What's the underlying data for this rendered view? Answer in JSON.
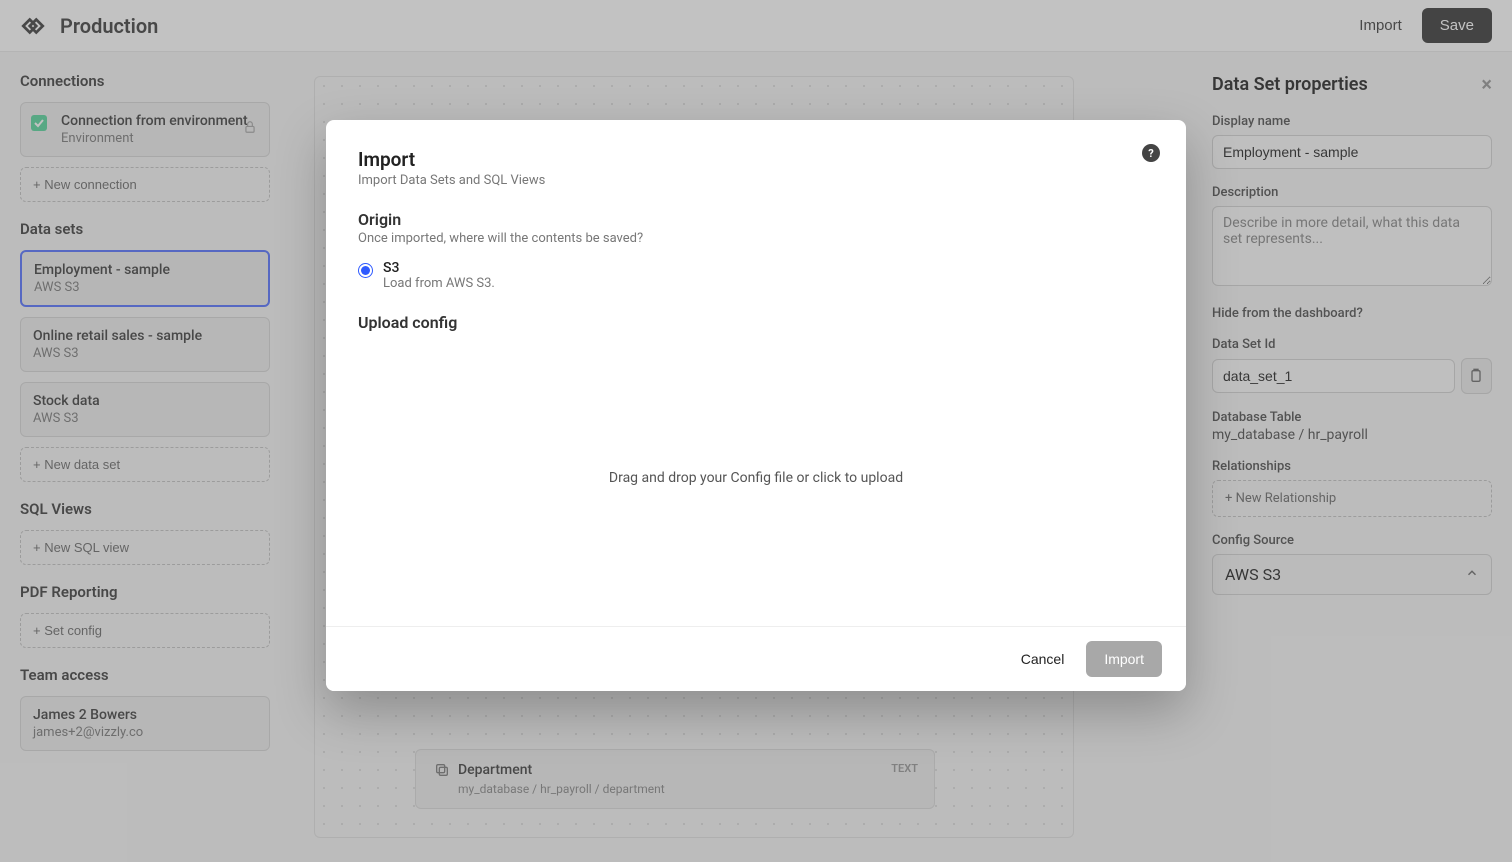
{
  "topbar": {
    "title": "Production",
    "import_label": "Import",
    "save_label": "Save"
  },
  "sidebar": {
    "connections": {
      "header": "Connections",
      "items": [
        {
          "title": "Connection from environment",
          "sub": "Environment"
        }
      ],
      "add_label": "+ New connection"
    },
    "datasets": {
      "header": "Data sets",
      "items": [
        {
          "title": "Employment - sample",
          "sub": "AWS S3",
          "active": true
        },
        {
          "title": "Online retail sales - sample",
          "sub": "AWS S3"
        },
        {
          "title": "Stock data",
          "sub": "AWS S3"
        }
      ],
      "add_label": "+ New data set"
    },
    "sqlviews": {
      "header": "SQL Views",
      "add_label": "+ New SQL view"
    },
    "pdf": {
      "header": "PDF Reporting",
      "add_label": "+ Set config"
    },
    "team": {
      "header": "Team access",
      "user_name": "James 2 Bowers",
      "user_email": "james+2@vizzly.co"
    }
  },
  "canvas": {
    "field": {
      "name": "Department",
      "type": "TEXT",
      "path": "my_database / hr_payroll / department"
    }
  },
  "props": {
    "title": "Data Set properties",
    "display_name_label": "Display name",
    "display_name_value": "Employment - sample",
    "description_label": "Description",
    "description_placeholder": "Describe in more detail, what this data set represents...",
    "hide_label": "Hide from the dashboard?",
    "id_label": "Data Set Id",
    "id_value": "data_set_1",
    "db_label": "Database Table",
    "db_value": "my_database / hr_payroll",
    "rel_label": "Relationships",
    "rel_add": "+ New Relationship",
    "config_label": "Config Source",
    "config_value": "AWS S3"
  },
  "modal": {
    "title": "Import",
    "subtitle": "Import Data Sets and SQL Views",
    "origin_title": "Origin",
    "origin_sub": "Once imported, where will the contents be saved?",
    "radio_s3_label": "S3",
    "radio_s3_desc": "Load from AWS S3.",
    "upload_title": "Upload config",
    "upload_zone": "Drag and drop your Config file or click to upload",
    "cancel": "Cancel",
    "import": "Import",
    "help": "?"
  }
}
